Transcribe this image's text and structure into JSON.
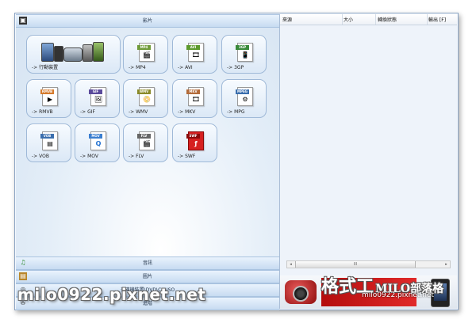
{
  "left_panel": {
    "video_header": "影片",
    "audio_header": "音訊",
    "image_header": "圖片",
    "rom_header": "光碟機裝置\\DVD\\CD\\ISO",
    "tools_header": "進階"
  },
  "tiles": [
    {
      "label": "-> 行動裝置",
      "tag": "",
      "color": ""
    },
    {
      "label": "-> MP4",
      "tag": "MP4",
      "color": "#6f9b3a",
      "glyph": "🎬"
    },
    {
      "label": "-> AVI",
      "tag": "AVI",
      "color": "#5c9a2d",
      "glyph": "🎞"
    },
    {
      "label": "-> 3GP",
      "tag": "3GP",
      "color": "#3a8a3a",
      "glyph": "📱"
    },
    {
      "label": "-> RMVB",
      "tag": "RMVB",
      "color": "#d57a2b",
      "glyph": "▶"
    },
    {
      "label": "-> GIF",
      "tag": "GIF",
      "color": "#5b4b9b",
      "glyph": "🖼"
    },
    {
      "label": "-> WMV",
      "tag": "WMV",
      "color": "#8a8a2a",
      "glyph": "📀"
    },
    {
      "label": "-> MKV",
      "tag": "MKV",
      "color": "#b36b3a",
      "glyph": "🎞"
    },
    {
      "label": "-> MPG",
      "tag": "MPEG",
      "color": "#3b6fae",
      "glyph": "⚙"
    },
    {
      "label": "-> VOB",
      "tag": "VOB",
      "color": "#3b6fae",
      "glyph": "▤"
    },
    {
      "label": "-> MOV",
      "tag": "MOV",
      "color": "#3b7fd0",
      "glyph": "Q"
    },
    {
      "label": "-> FLV",
      "tag": "FLV",
      "color": "#666666",
      "glyph": "🎬"
    },
    {
      "label": "-> SWF",
      "tag": "SWF",
      "color": "#cc1f1f",
      "glyph": "ƒ"
    }
  ],
  "file_list": {
    "columns": [
      "來源",
      "大小",
      "轉換狀態",
      "輸出 [F]"
    ],
    "scroll_thumb": "III"
  },
  "banner": {
    "watermark_title": "格式工",
    "brand": "MILO部落格",
    "url": "milo0922.pixnet.net"
  },
  "watermark": "milo0922.pixnet.net"
}
